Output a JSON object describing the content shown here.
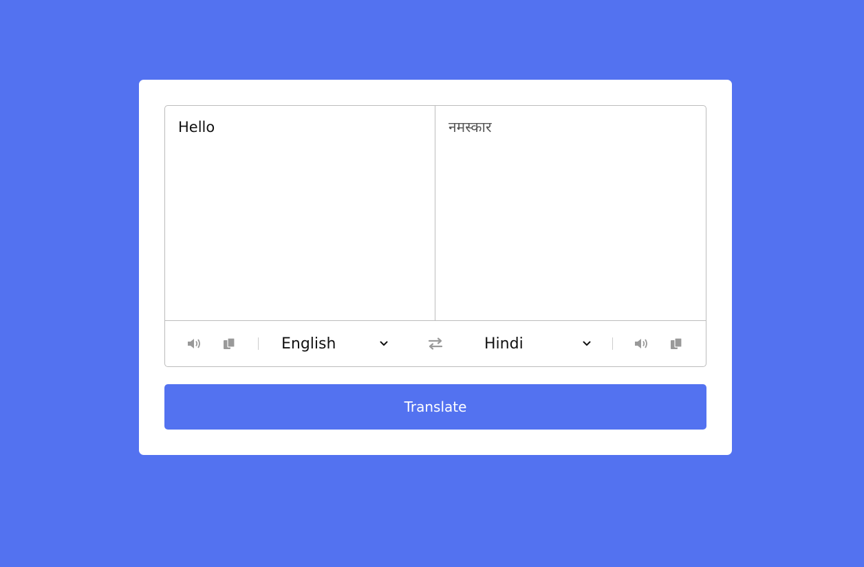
{
  "translator": {
    "from_text": "Hello",
    "to_text": "नमस्कार",
    "from_language": "English",
    "to_language": "Hindi",
    "translate_label": "Translate"
  },
  "icons": {
    "speaker": "speaker-icon",
    "copy": "copy-icon",
    "exchange": "exchange-icon",
    "dropdown": "chevron-down-icon"
  },
  "colors": {
    "background": "#5372F0",
    "card": "#ffffff",
    "button": "#5372F0",
    "icon": "#999999",
    "border": "#bbbbbb"
  }
}
